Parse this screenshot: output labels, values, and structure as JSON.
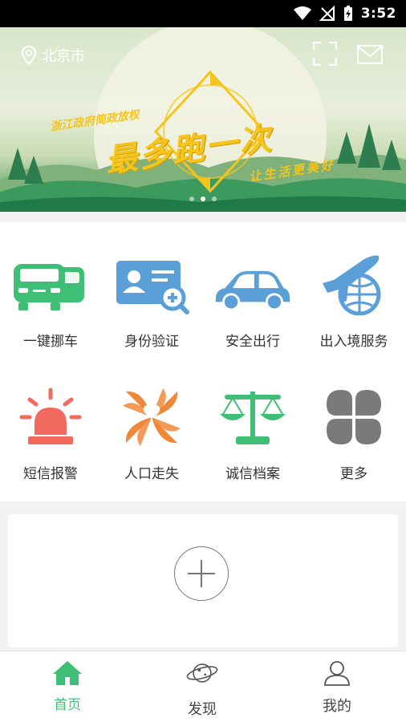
{
  "status_bar": {
    "time": "3:52"
  },
  "header": {
    "city": "北京市"
  },
  "banner": {
    "subtitle": "浙江政府简政放权",
    "title": "最多跑一次",
    "tagline": "让生活更美好",
    "slides": 3,
    "active_slide": 2
  },
  "services": [
    {
      "label": "一键挪车",
      "icon": "car-icon"
    },
    {
      "label": "身份验证",
      "icon": "id-card-search-icon"
    },
    {
      "label": "安全出行",
      "icon": "sedan-icon"
    },
    {
      "label": "出入境服务",
      "icon": "plane-globe-icon"
    },
    {
      "label": "短信报警",
      "icon": "alarm-light-icon"
    },
    {
      "label": "人口走失",
      "icon": "pinwheel-heart-icon"
    },
    {
      "label": "诚信档案",
      "icon": "scales-icon"
    },
    {
      "label": "更多",
      "icon": "more-grid-icon"
    }
  ],
  "tabs": [
    {
      "label": "首页",
      "icon": "home-icon",
      "active": true
    },
    {
      "label": "发现",
      "icon": "planet-icon",
      "active": false
    },
    {
      "label": "我的",
      "icon": "user-icon",
      "active": false
    }
  ],
  "colors": {
    "accent": "#3fbf75",
    "banner_yellow": "#f6c41a",
    "alarm_red": "#f26a5d",
    "orange": "#f0883a",
    "blue": "#5b9fd8",
    "gray": "#7a7a7a"
  }
}
